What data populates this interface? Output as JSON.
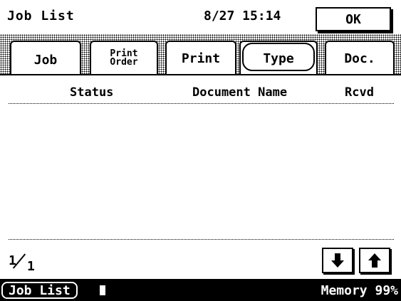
{
  "header": {
    "title": "Job List",
    "datetime": "8/27 15:14",
    "ok_label": "OK"
  },
  "tabs": [
    {
      "label": "Job",
      "active": true
    },
    {
      "label_line1": "Print",
      "label_line2": "Order"
    },
    {
      "label": "Print"
    },
    {
      "label": "Type",
      "highlighted": true
    },
    {
      "label": "Doc."
    }
  ],
  "table": {
    "columns": [
      "Status",
      "Document Name",
      "Rcvd"
    ],
    "rows": []
  },
  "pager": {
    "current": "1",
    "total": "1"
  },
  "statusbar": {
    "job_list_label": "Job List",
    "memory": "Memory 99%"
  },
  "icons": {
    "down": "arrow-down-icon",
    "up": "arrow-up-icon"
  }
}
